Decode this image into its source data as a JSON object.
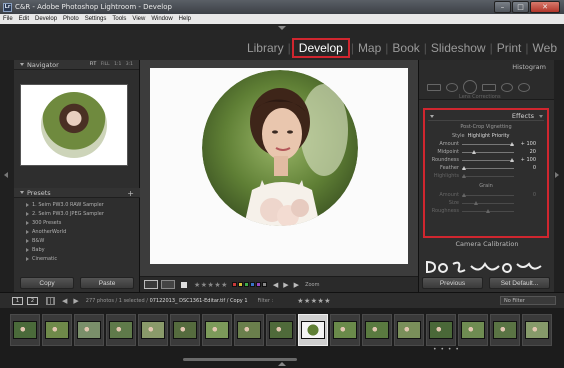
{
  "window": {
    "icon_text": "Lr",
    "title": "C&R - Adobe Photoshop Lightroom - Develop",
    "min_symbol": "–",
    "max_symbol": "□",
    "close_symbol": "✕"
  },
  "menu": [
    "File",
    "Edit",
    "Develop",
    "Photo",
    "Settings",
    "Tools",
    "View",
    "Window",
    "Help"
  ],
  "modules": [
    {
      "label": "Library",
      "active": false
    },
    {
      "label": "Develop",
      "active": true
    },
    {
      "label": "Map",
      "active": false
    },
    {
      "label": "Book",
      "active": false
    },
    {
      "label": "Slideshow",
      "active": false
    },
    {
      "label": "Print",
      "active": false
    },
    {
      "label": "Web",
      "active": false
    }
  ],
  "module_separator": "|",
  "navigator": {
    "title": "Navigator",
    "zoom_options": [
      "FIT",
      "FILL",
      "1:1",
      "3:1"
    ]
  },
  "presets": {
    "title": "Presets",
    "add_symbol": "+",
    "items": [
      "1. Seim PW3.0 RAW Sampler",
      "2. Seim PW3.0 JPEG Sampler",
      "300 Presets",
      "AnotherWorld",
      "B&W",
      "Baby",
      "Cinematic"
    ]
  },
  "left_buttons": {
    "copy": "Copy",
    "paste": "Paste"
  },
  "toolbar": {
    "stars": "★★★★★",
    "color_labels": [
      "#c93a3a",
      "#d8c23a",
      "#3fae4a",
      "#3a74c9",
      "#9a4ac0",
      "#8a8a8a"
    ],
    "zoom_label": "Zoom",
    "prev_arrow": "◀",
    "next_arrow": "▶",
    "play_symbol": "▶"
  },
  "histogram": {
    "title": "Histogram",
    "lens_corrections": "Lens Corrections"
  },
  "effects": {
    "title": "Effects",
    "vignette_title": "Post-Crop Vignetting",
    "style_label": "Style",
    "style_value": "Highlight Priority",
    "sliders": [
      {
        "label": "Amount",
        "value": "+ 100",
        "fraction": 1.0,
        "dim": false
      },
      {
        "label": "Midpoint",
        "value": "20",
        "fraction": 0.2,
        "dim": false
      },
      {
        "label": "Roundness",
        "value": "+ 100",
        "fraction": 1.0,
        "dim": false
      },
      {
        "label": "Feather",
        "value": "0",
        "fraction": 0.0,
        "dim": false
      },
      {
        "label": "Highlights",
        "value": "",
        "fraction": 0.0,
        "dim": true
      }
    ],
    "grain_title": "Grain",
    "grain_sliders": [
      {
        "label": "Amount",
        "value": "0",
        "fraction": 0.0,
        "dim": true
      },
      {
        "label": "Size",
        "value": "",
        "fraction": 0.25,
        "dim": true
      },
      {
        "label": "Roughness",
        "value": "",
        "fraction": 0.5,
        "dim": true
      }
    ]
  },
  "camera_calibration": "Camera Calibration",
  "right_buttons": {
    "previous": "Previous",
    "set_default": "Set Default..."
  },
  "filmbar": {
    "monitor_1": "1",
    "monitor_2": "2",
    "back_arrow": "◀",
    "forward_arrow": "▶",
    "info_prefix": "277 photos / 1 selected /",
    "filename": "07122013_ DSC1361-Editar.tif / Copy 1",
    "filter_label": "Filter :",
    "filter_stars": "★★★★★",
    "no_filter": "No Filter"
  },
  "filmstrip": {
    "thumbs": [
      {
        "color": "#4a6a3a",
        "selected": false
      },
      {
        "color": "#6f8a4a",
        "selected": false
      },
      {
        "color": "#7a8f6a",
        "selected": false
      },
      {
        "color": "#5f7a4a",
        "selected": false
      },
      {
        "color": "#8a9a6a",
        "selected": false
      },
      {
        "color": "#556b3e",
        "selected": false
      },
      {
        "color": "#7c9a5a",
        "selected": false
      },
      {
        "color": "#6a7f4c",
        "selected": false
      },
      {
        "color": "#4f6a3a",
        "selected": false
      },
      {
        "color": "#e9e6df",
        "selected": true
      },
      {
        "color": "#6a8a4a",
        "selected": false
      },
      {
        "color": "#5a7a40",
        "selected": false
      },
      {
        "color": "#7a8f5a",
        "selected": false
      },
      {
        "color": "#4a6838",
        "selected": false
      },
      {
        "color": "#6f8c52",
        "selected": false
      },
      {
        "color": "#5a7444",
        "selected": false
      },
      {
        "color": "#869a6a",
        "selected": false
      }
    ],
    "dots": "• • • •"
  }
}
